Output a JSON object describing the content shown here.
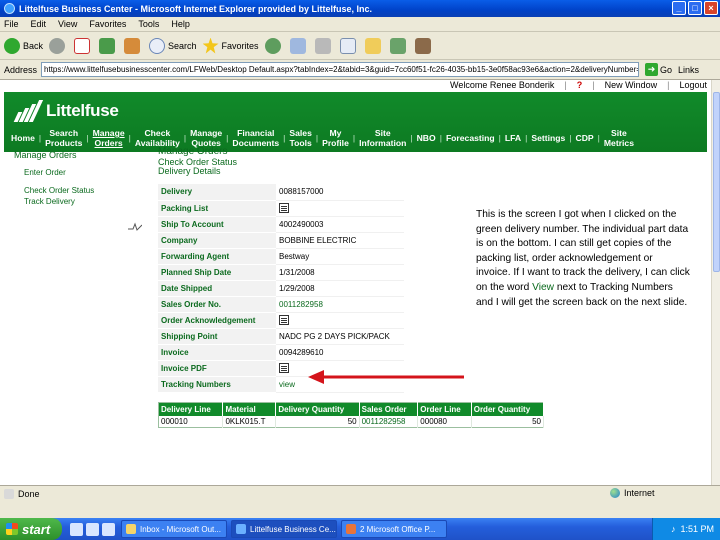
{
  "window": {
    "title": "Littelfuse Business Center - Microsoft Internet Explorer provided by Littelfuse, Inc.",
    "buttons": [
      "_",
      "□",
      "×"
    ]
  },
  "menu": [
    "File",
    "Edit",
    "View",
    "Favorites",
    "Tools",
    "Help"
  ],
  "toolbar": {
    "back": "Back",
    "search": "Search",
    "favorites": "Favorites"
  },
  "address": {
    "label": "Address",
    "url": "https://www.littelfusebusinesscenter.com/LFWeb/Desktop Default.aspx?tabIndex=2&tabid=3&guid=7cc60f51-fc26-4035-bb15-3e0f58ac93e6&action=2&deliveryNumber=",
    "go": "Go",
    "links": "Links"
  },
  "site": {
    "welcome": "Welcome Renee Bonderik",
    "new_window": "New Window",
    "logout": "Logout",
    "logo": "Littelfuse",
    "nav": [
      {
        "label": "Home",
        "active": false
      },
      {
        "label": "Search\nProducts",
        "active": false
      },
      {
        "label": "Manage\nOrders",
        "active": true
      },
      {
        "label": "Check\nAvailability",
        "active": false
      },
      {
        "label": "Manage\nQuotes",
        "active": false
      },
      {
        "label": "Financial\nDocuments",
        "active": false
      },
      {
        "label": "Sales\nTools",
        "active": false
      },
      {
        "label": "My\nProfile",
        "active": false
      },
      {
        "label": "Site\nInformation",
        "active": false
      },
      {
        "label": "NBO",
        "active": false
      },
      {
        "label": "Forecasting",
        "active": false
      },
      {
        "label": "LFA",
        "active": false
      },
      {
        "label": "Settings",
        "active": false
      },
      {
        "label": "CDP",
        "active": false
      },
      {
        "label": "Site\nMetrics",
        "active": false
      }
    ]
  },
  "sidebar": {
    "heading": "Manage Orders",
    "links": [
      "Enter Order",
      "Check Order Status",
      "Track Delivery"
    ]
  },
  "content": {
    "title": "Manage Orders",
    "subtitle1": "Check Order Status",
    "subtitle2": "Delivery Details",
    "details": [
      {
        "label": "Delivery",
        "value": "0088157000",
        "type": "text"
      },
      {
        "label": "Packing List",
        "value": "",
        "type": "doc"
      },
      {
        "label": "Ship To Account",
        "value": "4002490003",
        "type": "text"
      },
      {
        "label": "Company",
        "value": "BOBBINE ELECTRIC",
        "type": "text"
      },
      {
        "label": "Forwarding Agent",
        "value": "Bestway",
        "type": "text"
      },
      {
        "label": "Planned Ship Date",
        "value": "1/31/2008",
        "type": "text"
      },
      {
        "label": "Date Shipped",
        "value": "1/29/2008",
        "type": "text"
      },
      {
        "label": "Sales Order No.",
        "value": "0011282958",
        "type": "link"
      },
      {
        "label": "Order Acknowledgement",
        "value": "",
        "type": "doc"
      },
      {
        "label": "Shipping Point",
        "value": "NADC PG 2 DAYS PICK/PACK",
        "type": "text"
      },
      {
        "label": "Invoice",
        "value": "0094289610",
        "type": "text"
      },
      {
        "label": "Invoice PDF",
        "value": "",
        "type": "doc"
      },
      {
        "label": "Tracking Numbers",
        "value": "view",
        "type": "link"
      }
    ],
    "lines_headers": [
      "Delivery Line",
      "Material",
      "Delivery Quantity",
      "Sales Order",
      "Order Line",
      "Order Quantity"
    ],
    "lines_rows": [
      [
        "000010",
        "0KLK015.T",
        "50",
        "0011282958",
        "000080",
        "50"
      ]
    ]
  },
  "annotation": {
    "before": "This is the screen I got when I clicked on the green delivery number.  The individual part data is on the bottom.  I can still get copies of the packing list, order acknowledgement or invoice.  If I want to track the delivery, I can click on the word ",
    "highlight": "View",
    "after": " next to Tracking Numbers and I will get the screen back on the next slide."
  },
  "status": {
    "left": "Done",
    "zone": "Internet"
  },
  "taskbar": {
    "start": "start",
    "tasks": [
      "Inbox - Microsoft Out...",
      "Littelfuse Business Ce...",
      "2 Microsoft Office P..."
    ],
    "clock": "1:51 PM"
  },
  "colors": {
    "brand_green": "#118a2a",
    "link_green": "#0b6a1e",
    "arrow_red": "#d4141b"
  }
}
